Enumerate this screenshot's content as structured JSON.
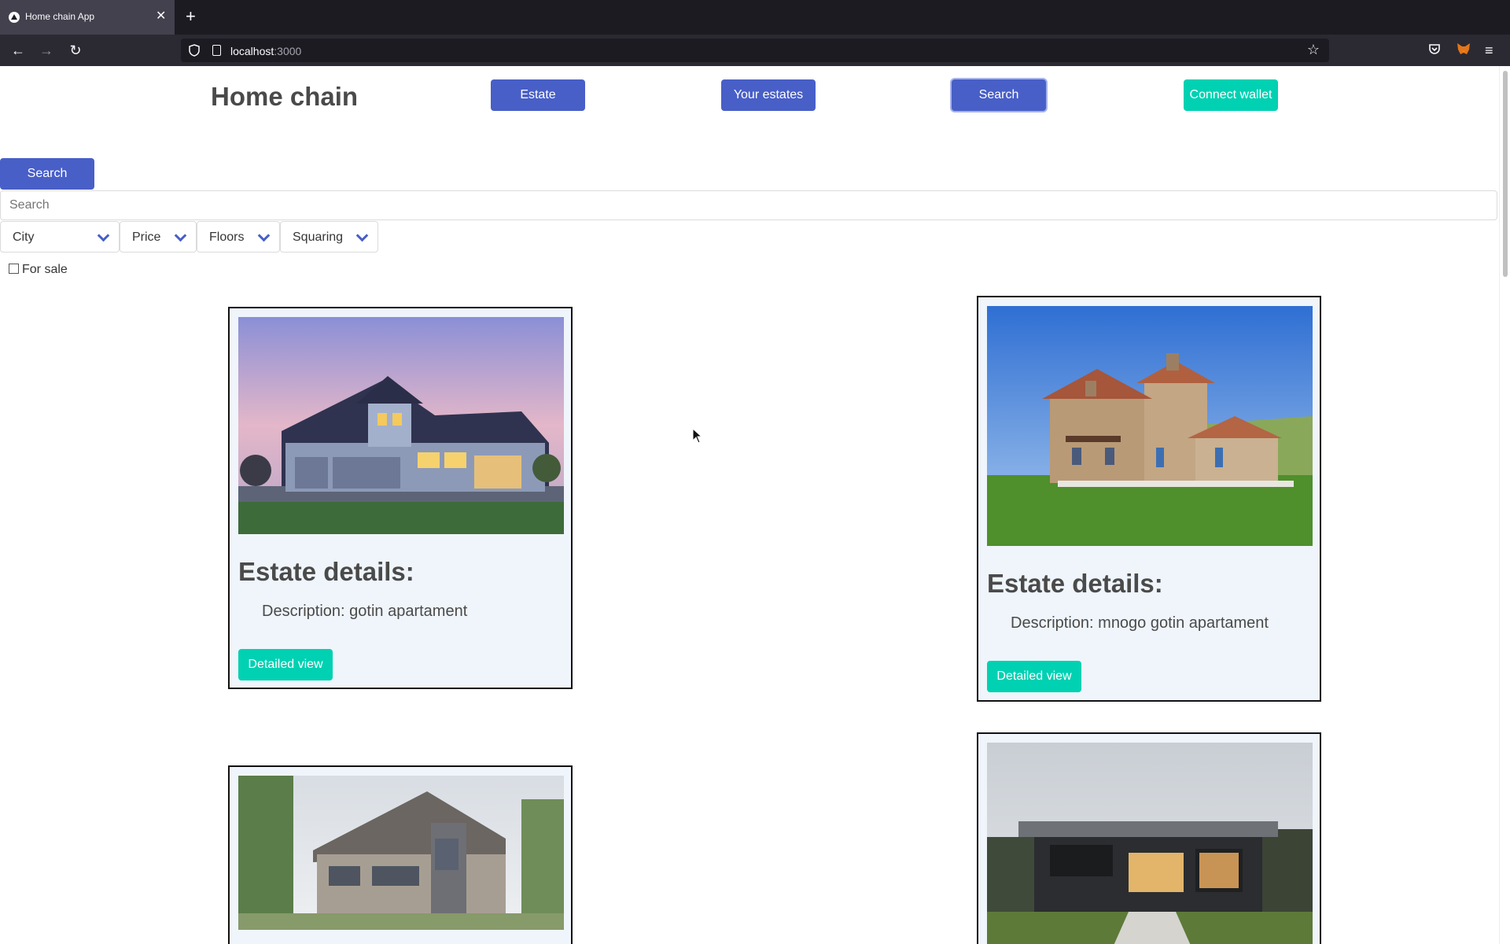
{
  "browser": {
    "tab_title": "Home chain App",
    "url_host": "localhost",
    "url_port": ":3000"
  },
  "header": {
    "brand": "Home chain",
    "nav": {
      "estate": "Estate",
      "your_estates": "Your estates",
      "search": "Search",
      "connect_wallet": "Connect wallet"
    }
  },
  "search": {
    "button": "Search",
    "placeholder": "Search",
    "filters": {
      "city": "City",
      "price": "Price",
      "floors": "Floors",
      "squaring": "Squaring"
    },
    "for_sale": "For sale"
  },
  "estates": [
    {
      "title": "Estate details:",
      "description": "Description: gotin apartament",
      "button": "Detailed view"
    },
    {
      "title": "Estate details:",
      "description": "Description: mnogo gotin apartament",
      "button": "Detailed view"
    }
  ],
  "colors": {
    "primary": "#485fc7",
    "accent": "#00d1b2",
    "card_bg": "#eff5fb"
  }
}
